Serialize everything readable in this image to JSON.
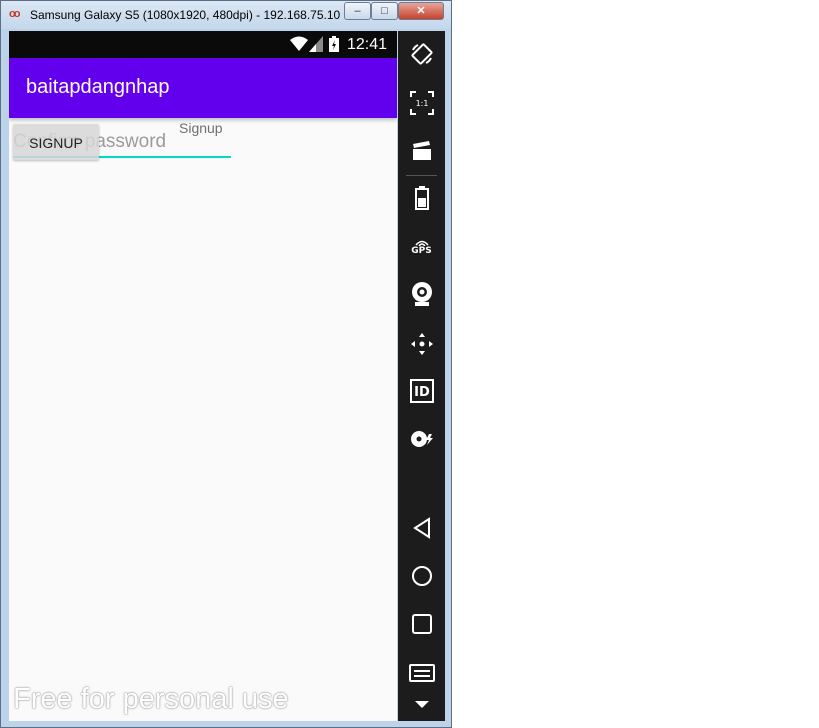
{
  "window": {
    "title": "Samsung Galaxy S5 (1080x1920, 480dpi) - 192.168.75.10...",
    "app_icon": "genymotion-icon",
    "buttons": {
      "minimize": "–",
      "maximize": "□",
      "close": "✕"
    }
  },
  "statusbar": {
    "time": "12:41",
    "icons": [
      "wifi-icon",
      "signal-icon",
      "battery-icon"
    ]
  },
  "appbar": {
    "title": "baitapdangnhap"
  },
  "form": {
    "label": "Signup",
    "password_placeholder": "Confirm password",
    "signup_button": "SIGNUP"
  },
  "watermark": "Free for personal use",
  "toolbar": {
    "items": [
      "rotate-icon",
      "scale-1to1-icon",
      "screencast-icon",
      "battery-icon",
      "gps-icon",
      "camera-icon",
      "dpad-icon",
      "device-id-icon",
      "disk-icon",
      "back-icon",
      "home-icon",
      "recent-apps-icon",
      "menu-icon",
      "scroll-down-icon"
    ],
    "scale_label": "1:1",
    "gps_label": "GPS",
    "id_label": "ID"
  },
  "colors": {
    "appbar": "#6200ee",
    "accent": "#03dac5",
    "statusbar": "#0a0a0a",
    "toolbar": "#1c1c1c"
  }
}
